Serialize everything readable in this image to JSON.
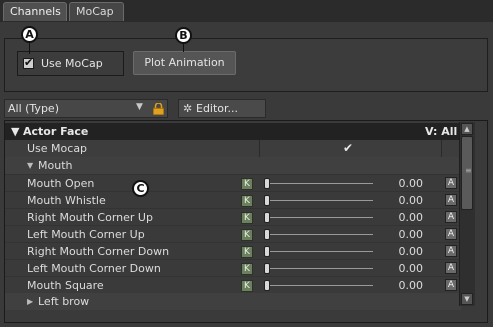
{
  "tabs": [
    {
      "label": "Channels",
      "active": true
    },
    {
      "label": "MoCap",
      "active": false
    }
  ],
  "top": {
    "use_mocap_label": "Use MoCap",
    "use_mocap_checked": true,
    "plot_animation_label": "Plot Animation"
  },
  "callouts": {
    "a": "A",
    "b": "B",
    "c": "C"
  },
  "filter": {
    "type_value": "All (Type)",
    "editor_label": "Editor..."
  },
  "grid": {
    "header_label": "Actor Face",
    "header_right": "V: All",
    "use_mocap_row_label": "Use Mocap",
    "mouth_group": "Mouth",
    "left_brow_group": "Left brow",
    "key_button": "K",
    "anim_button": "A",
    "params": [
      {
        "label": "Mouth Open",
        "value": "0.00"
      },
      {
        "label": "Mouth Whistle",
        "value": "0.00"
      },
      {
        "label": "Right Mouth Corner Up",
        "value": "0.00"
      },
      {
        "label": "Left Mouth Corner Up",
        "value": "0.00"
      },
      {
        "label": "Right Mouth Corner Down",
        "value": "0.00"
      },
      {
        "label": "Left Mouth Corner Down",
        "value": "0.00"
      },
      {
        "label": "Mouth Square",
        "value": "0.00"
      }
    ]
  },
  "colors": {
    "background": "#3a3a3a",
    "header_bg": "#222222",
    "key_button": "#6c8060",
    "lock_icon": "#e0a020"
  },
  "icons": [
    "check-icon",
    "chevron-down-icon",
    "lock-icon",
    "gear-icon",
    "triangle-down-icon",
    "triangle-right-icon",
    "scroll-up-icon",
    "scroll-down-icon"
  ]
}
